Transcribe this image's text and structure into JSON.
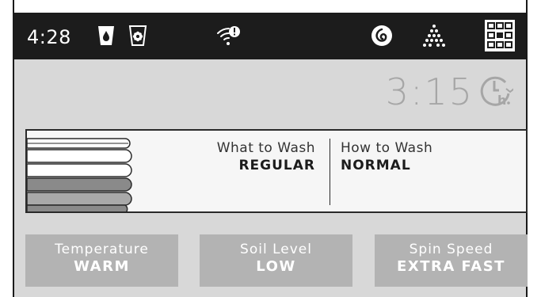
{
  "status_bar": {
    "time": "4:28",
    "icons": [
      "detergent-drop-icon",
      "softener-flower-icon",
      "wifi-alert-icon",
      "smart-dispense-icon",
      "steam-spray-icon",
      "keypad-grid-icon"
    ]
  },
  "timer": {
    "time_remaining": "3:15",
    "icon": "delay-hours-icon"
  },
  "cycle": {
    "what_to_wash_label": "What to Wash",
    "what_to_wash_value": "REGULAR",
    "how_to_wash_label": "How to Wash",
    "how_to_wash_value": "NORMAL",
    "icon": "folded-towels-icon"
  },
  "settings": [
    {
      "label": "Temperature",
      "value": "WARM"
    },
    {
      "label": "Soil Level",
      "value": "LOW"
    },
    {
      "label": "Spin Speed",
      "value": "EXTRA FAST"
    }
  ],
  "colors": {
    "status_bar_bg": "#1c1c1c",
    "panel_bg": "#d8d8d8",
    "setting_button_bg": "#b3b3b3",
    "timer_text": "#a6a6a6"
  }
}
